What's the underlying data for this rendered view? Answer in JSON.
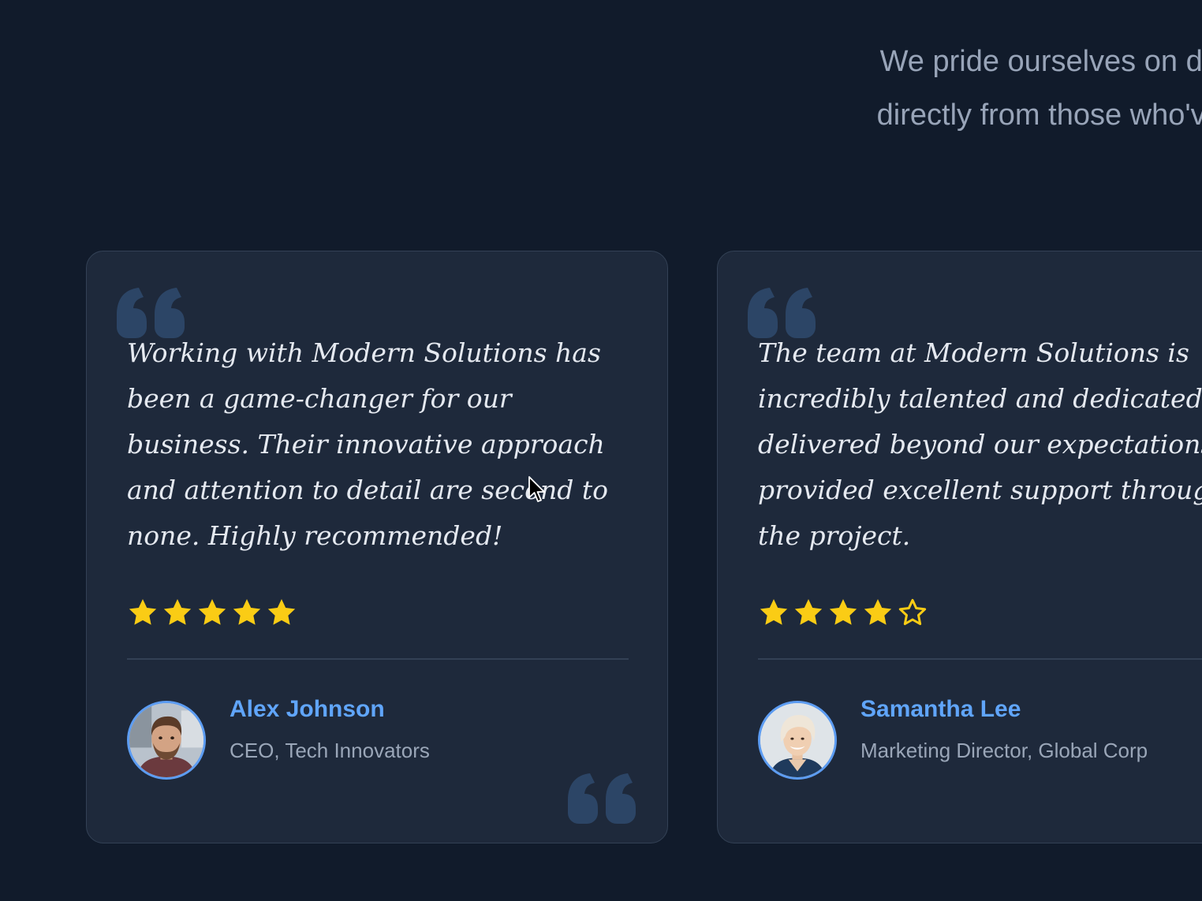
{
  "intro": {
    "line1": "We pride ourselves on delivering exceptional ser",
    "line2": "directly from those who've experienced the Mode"
  },
  "testimonials": [
    {
      "quote": "Working with Modern Solutions has been a game-changer for our business. Their innovative approach and attention to detail are second to none. Highly recommended!",
      "rating": 5,
      "rating_max": 5,
      "name": "Alex Johnson",
      "role": "CEO, Tech Innovators",
      "avatar_icon": "avatar-photo-man-beard"
    },
    {
      "quote": "The team at Modern Solutions is incredibly talented and dedicated. T delivered beyond our expectations a provided excellent support througho the project.",
      "rating": 4,
      "rating_max": 5,
      "name": "Samantha Lee",
      "role": "Marketing Director, Global Corp",
      "avatar_icon": "avatar-photo-woman-short-hair"
    }
  ],
  "colors": {
    "background": "#111b2b",
    "card": "#1e293b",
    "accent": "#60a5fa",
    "star": "#facc15",
    "quote_mark": "#2c4566"
  },
  "icons": {
    "quote": "quote-mark-icon",
    "star_filled": "star-filled-icon",
    "star_empty": "star-outline-icon",
    "cursor": "mouse-pointer-icon"
  }
}
